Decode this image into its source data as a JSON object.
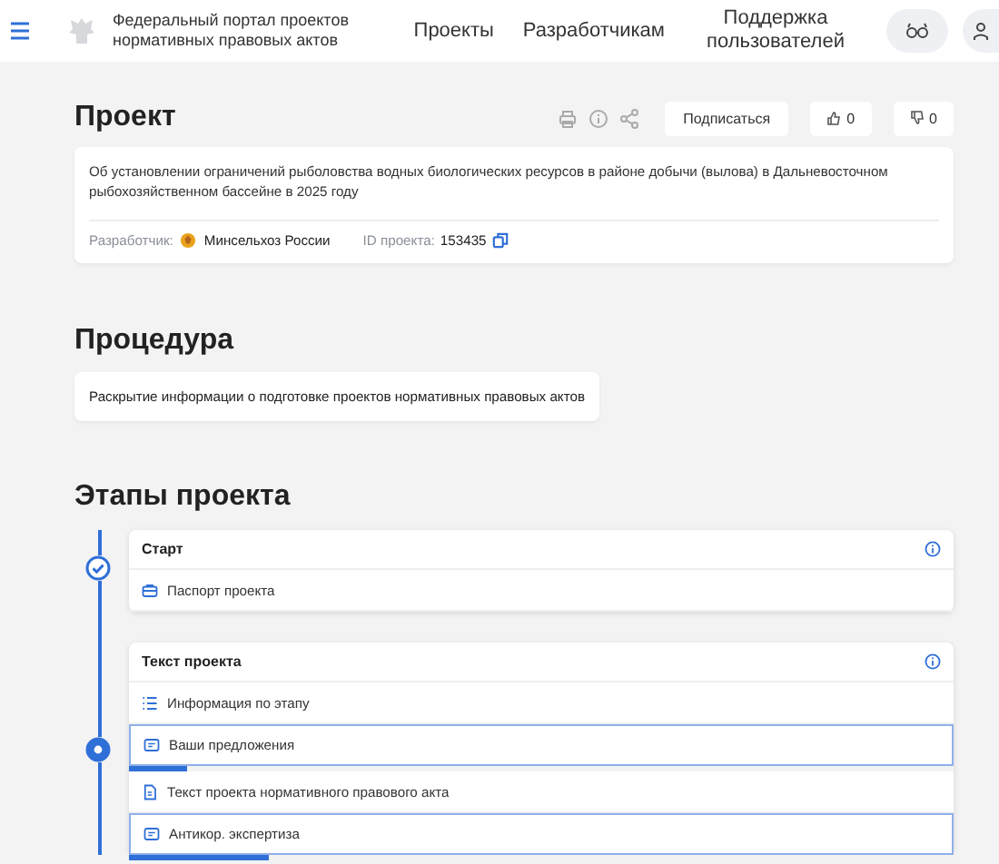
{
  "header": {
    "portal_title": "Федеральный портал проектов нормативных правовых актов",
    "nav": [
      "Проекты",
      "Разработчикам",
      "Поддержка пользователей"
    ]
  },
  "project": {
    "heading": "Проект",
    "subscribe": "Подписаться",
    "likes": "0",
    "dislikes": "0",
    "description": "Об установлении ограничений рыболовства водных биологических ресурсов в районе добычи (вылова) в Дальневосточном рыбохозяйственном бассейне в 2025 году",
    "developer_label": "Разработчик:",
    "developer": "Минсельхоз России",
    "id_label": "ID проекта:",
    "id": "153435"
  },
  "procedure": {
    "heading": "Процедура",
    "text": "Раскрытие информации о подготовке проектов нормативных правовых актов"
  },
  "stages": {
    "heading": "Этапы проекта",
    "items": [
      {
        "title": "Старт",
        "completed": true,
        "rows": [
          {
            "kind": "passport",
            "label": "Паспорт проекта"
          }
        ]
      },
      {
        "title": "Текст проекта",
        "completed": false,
        "rows": [
          {
            "kind": "info",
            "label": "Информация по этапу"
          },
          {
            "kind": "progress",
            "label": "Ваши предложения",
            "level": 0.07
          },
          {
            "kind": "document",
            "label": "Текст проекта нормативного правового акта"
          },
          {
            "kind": "progress",
            "label": "Антикор. экспертиза",
            "level": 0.17
          }
        ]
      }
    ]
  }
}
